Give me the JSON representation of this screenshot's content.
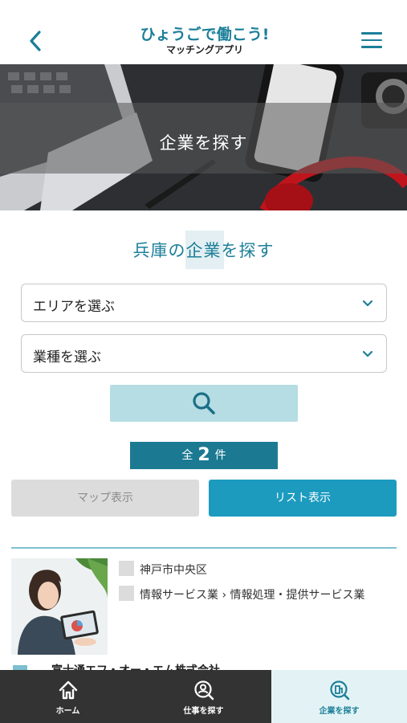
{
  "header": {
    "logo_main": "ひょうごで働こう!",
    "logo_sub": "マッチングアプリ"
  },
  "hero": {
    "title": "企業を探す"
  },
  "search": {
    "heading": "兵庫の企業を探す",
    "area_select": "エリアを選ぶ",
    "industry_select": "業種を選ぶ"
  },
  "results": {
    "count_prefix": "全",
    "count": "2",
    "count_suffix": "件",
    "map_view_label": "マップ表示",
    "list_view_label": "リスト表示",
    "items": [
      {
        "location": "神戸市中央区",
        "industry": "情報サービス業 › 情報処理・提供サービス業",
        "company_name_partial": "富士通エフ・オー・エム株式会社"
      }
    ]
  },
  "bottom_nav": {
    "items": [
      {
        "label": "ホーム",
        "icon": "home-icon"
      },
      {
        "label": "仕事を探す",
        "icon": "person-search-icon"
      },
      {
        "label": "企業を探す",
        "icon": "building-search-icon",
        "active": true
      }
    ]
  },
  "colors": {
    "brand": "#1c7f99",
    "accent_button": "#1c9bbf",
    "search_button": "#b5dde3",
    "nav_background": "#333333",
    "nav_active": "#e3f3f5"
  }
}
